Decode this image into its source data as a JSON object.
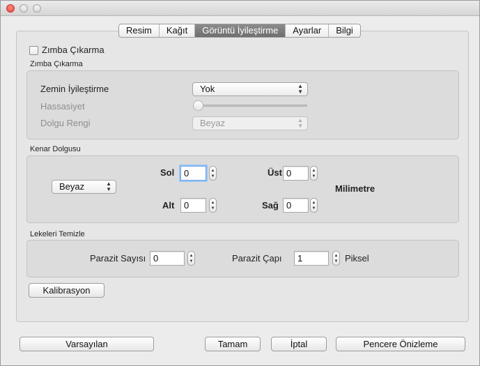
{
  "tabs": {
    "resim": "Resim",
    "kagit": "Kağıt",
    "goruntu": "Görüntü İyileştirme",
    "ayarlar": "Ayarlar",
    "bilgi": "Bilgi"
  },
  "zimba": {
    "checkbox_label": "Zımba Çıkarma",
    "group_title": "Zımba Çıkarma",
    "zemin_label": "Zemin İyileştirme",
    "zemin_value": "Yok",
    "hassasiyet_label": "Hassasiyet",
    "hassasiyet_level": 0,
    "dolgu_label": "Dolgu Rengi",
    "dolgu_value": "Beyaz"
  },
  "kenar": {
    "group_title": "Kenar Dolgusu",
    "color_value": "Beyaz",
    "sol_label": "Sol",
    "sol_value": "0",
    "alt_label": "Alt",
    "alt_value": "0",
    "ust_label": "Üst",
    "ust_value": "0",
    "sag_label": "Sağ",
    "sag_value": "0",
    "unit": "Milimetre"
  },
  "leke": {
    "group_title": "Lekeleri Temizle",
    "sayi_label": "Parazit Sayısı",
    "sayi_value": "0",
    "cap_label": "Parazit Çapı",
    "cap_value": "1",
    "unit": "Piksel"
  },
  "buttons": {
    "kalibrasyon": "Kalibrasyon",
    "varsayilan": "Varsayılan",
    "tamam": "Tamam",
    "iptal": "İptal",
    "onizleme": "Pencere Önizleme"
  }
}
